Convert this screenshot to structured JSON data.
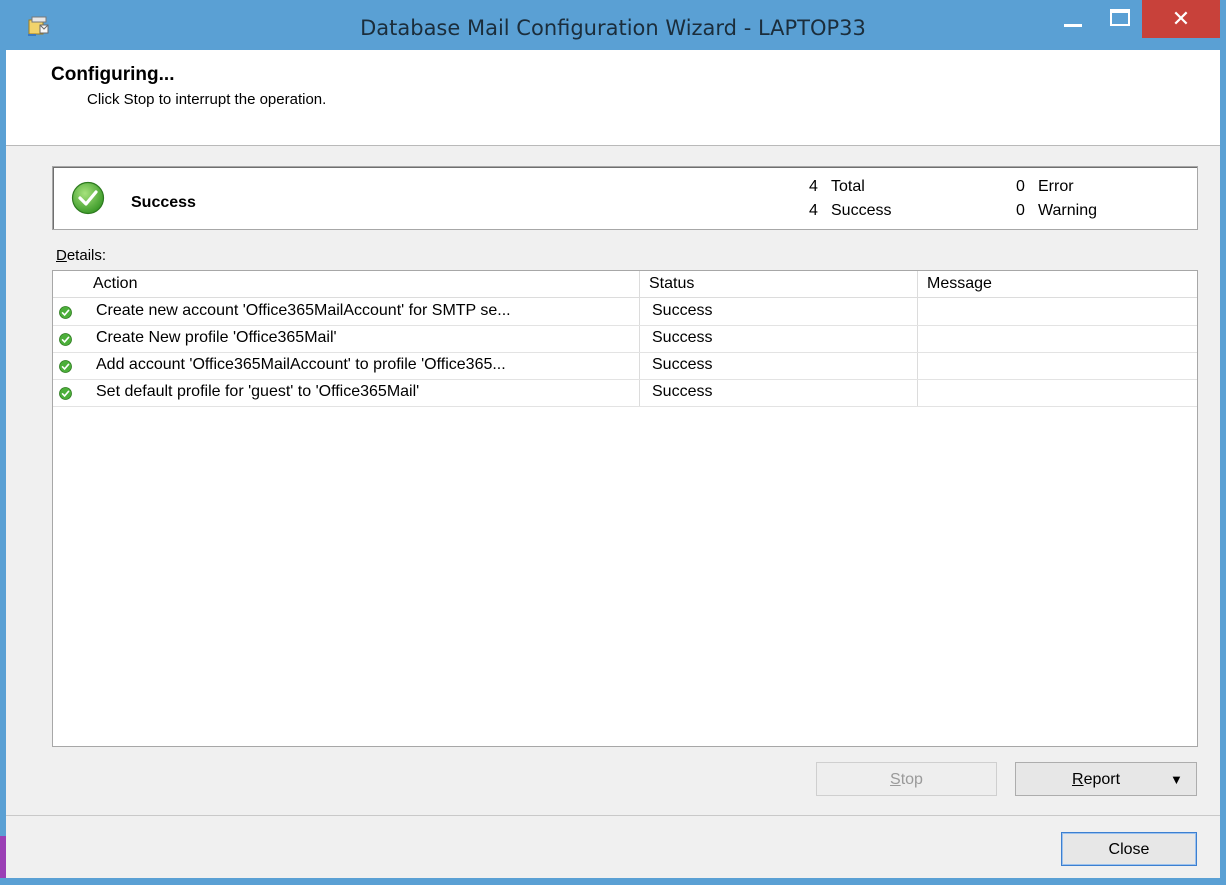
{
  "window": {
    "title": "Database Mail Configuration Wizard - LAPTOP33",
    "close_glyph": "✕"
  },
  "header": {
    "title": "Configuring...",
    "subtitle": "Click Stop to interrupt the operation."
  },
  "summary": {
    "status": "Success",
    "total_count": "4",
    "total_label": "Total",
    "success_count": "4",
    "success_label": "Success",
    "error_count": "0",
    "error_label": "Error",
    "warning_count": "0",
    "warning_label": "Warning"
  },
  "details": {
    "label_mnemonic": "D",
    "label_rest": "etails:",
    "columns": [
      "Action",
      "Status",
      "Message"
    ],
    "rows": [
      {
        "action": "Create new account 'Office365MailAccount' for SMTP se...",
        "status": "Success",
        "message": ""
      },
      {
        "action": "Create New profile 'Office365Mail'",
        "status": "Success",
        "message": ""
      },
      {
        "action": "Add account 'Office365MailAccount' to profile 'Office365...",
        "status": "Success",
        "message": ""
      },
      {
        "action": "Set default profile for 'guest' to 'Office365Mail'",
        "status": "Success",
        "message": ""
      }
    ]
  },
  "buttons": {
    "stop_mnemonic": "S",
    "stop_rest": "top",
    "report_mnemonic": "R",
    "report_rest": "eport",
    "report_arrow": "▼",
    "close": "Close"
  },
  "colors": {
    "titlebar": "#5aa0d4",
    "close_button": "#c8413a",
    "success_green": "#4caf3a"
  },
  "icons": {
    "app": "database-mail-wizard-icon",
    "success": "green-check-circle-icon"
  }
}
